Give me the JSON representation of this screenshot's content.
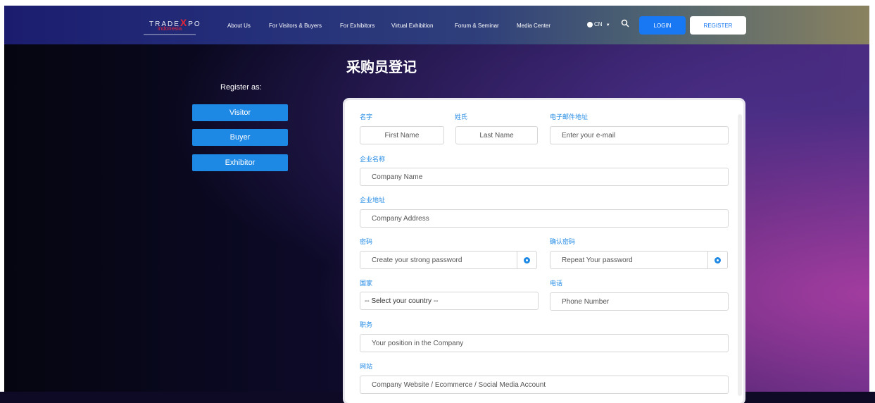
{
  "colors": {
    "accent": "#1e88e5",
    "login_bg": "#1877f2",
    "nav_start": "#1b1c6e",
    "nav_end": "#8a8260"
  },
  "nav": {
    "logo": {
      "line1_a": "TRADE",
      "line1_x": "X",
      "line1_b": "PO",
      "line2": "indonesia"
    },
    "items": [
      "About Us",
      "For Visitors & Buyers",
      "For Exhibitors",
      "Virtual Exhibition",
      "Forum & Seminar",
      "Media Center"
    ],
    "lang": "CN",
    "login": "LOGIN",
    "register": "REGISTER"
  },
  "page_title": "采购员登记",
  "register_as": {
    "label": "Register as:",
    "options": [
      "Visitor",
      "Buyer",
      "Exhibitor"
    ]
  },
  "form": {
    "first_name": {
      "label": "名字",
      "placeholder": "First Name"
    },
    "last_name": {
      "label": "姓氏",
      "placeholder": "Last Name"
    },
    "email": {
      "label": "电子邮件地址",
      "placeholder": "Enter your e-mail"
    },
    "company_name": {
      "label": "企业名称",
      "placeholder": "Company Name"
    },
    "company_address": {
      "label": "企业地址",
      "placeholder": "Company Address"
    },
    "password": {
      "label": "密码",
      "placeholder": "Create your strong password"
    },
    "confirm_password": {
      "label": "确认密码",
      "placeholder": "Repeat Your password"
    },
    "country": {
      "label": "国家",
      "value": "-- Select your country --"
    },
    "phone": {
      "label": "电话",
      "placeholder": "Phone Number"
    },
    "position": {
      "label": "职务",
      "placeholder": "Your position in the Company"
    },
    "website": {
      "label": "网站",
      "placeholder": "Company Website / Ecommerce / Social Media Account"
    }
  }
}
